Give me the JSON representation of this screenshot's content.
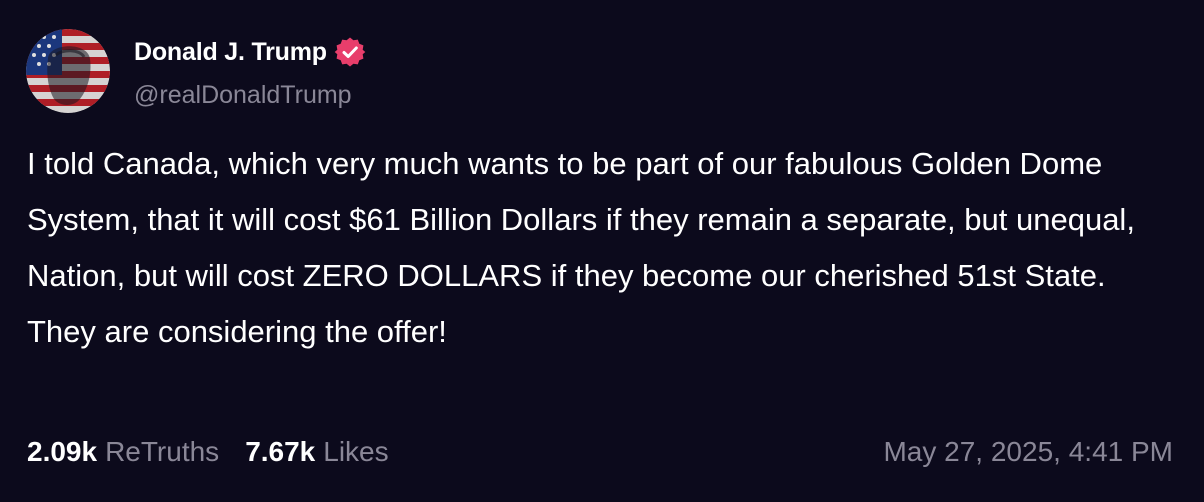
{
  "author": {
    "name": "Donald J. Trump",
    "handle": "@realDonaldTrump",
    "verified_icon": "verified-badge-icon",
    "badge_color": "#e83e6b"
  },
  "post": {
    "text": "I told Canada, which very much wants to be part of our fabulous Golden Dome System, that it will cost $61 Billion Dollars if they remain a separate, but unequal, Nation, but will cost ZERO DOLLARS if they become our cherished 51st State. They are considering the offer!"
  },
  "stats": {
    "retruths_count": "2.09k",
    "retruths_label": "ReTruths",
    "likes_count": "7.67k",
    "likes_label": "Likes"
  },
  "timestamp": "May 27, 2025, 4:41 PM",
  "colors": {
    "background": "#0c0a1c",
    "text_primary": "#ffffff",
    "text_secondary": "#8a8797"
  }
}
